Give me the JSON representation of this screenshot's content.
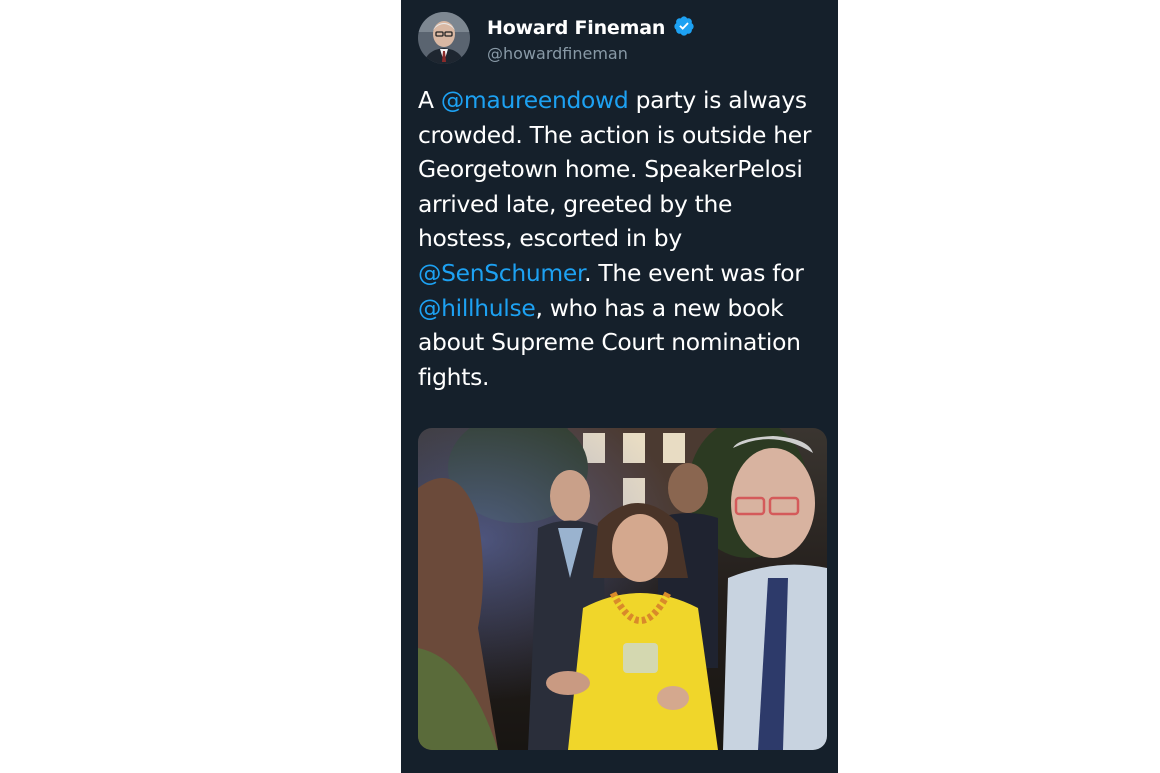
{
  "tweet": {
    "author": {
      "display_name": "Howard Fineman",
      "handle": "@howardfineman",
      "verified": true,
      "verified_icon": "verified-badge-icon"
    },
    "text_lines": [
      [
        {
          "t": "A "
        },
        {
          "t": "@maureendowd",
          "mention": true
        },
        {
          "t": " party is always"
        }
      ],
      [
        {
          "t": "crowded. The action is outside her"
        }
      ],
      [
        {
          "t": "Georgetown home. SpeakerPelosi"
        }
      ],
      [
        {
          "t": "arrived late, greeted by the"
        }
      ],
      [
        {
          "t": "hostess, escorted in by"
        }
      ],
      [
        {
          "t": "@SenSchumer",
          "mention": true
        },
        {
          "t": ". The event was for"
        }
      ],
      [
        {
          "t": "@hillhulse",
          "mention": true
        },
        {
          "t": ", who has a new book"
        }
      ],
      [
        {
          "t": "about Supreme Court nomination"
        }
      ],
      [
        {
          "t": "fights."
        }
      ]
    ]
  },
  "colors": {
    "card_background": "#15202b",
    "text": "#ffffff",
    "secondary_text": "#8899a6",
    "mention": "#1da1f2",
    "page_background": "#ffffff"
  }
}
